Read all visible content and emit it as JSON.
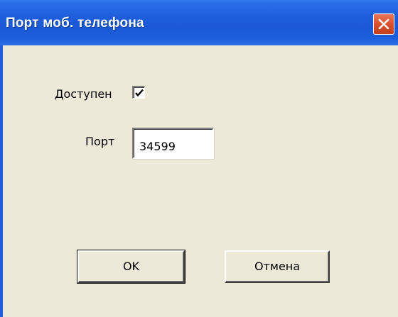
{
  "window": {
    "title": "Порт моб. телефона",
    "close_icon": "close-icon",
    "accent_color": "#1f5fdc",
    "close_color": "#d9502c"
  },
  "form": {
    "available_label": "Доступен",
    "available_checked": true,
    "port_label": "Порт",
    "port_value": "34599"
  },
  "buttons": {
    "ok_label": "OK",
    "cancel_label": "Отмена"
  }
}
